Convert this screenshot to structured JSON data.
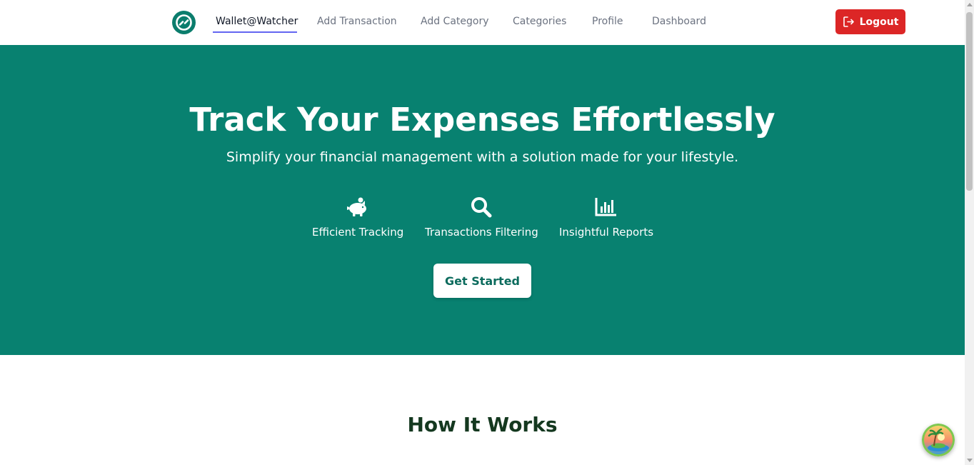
{
  "nav": {
    "brand": "Wallet@Watcher",
    "links": [
      "Add Transaction",
      "Add Category",
      "Categories",
      "Profile",
      "Dashboard"
    ],
    "logout_label": "Logout",
    "accent_color": "#6366f1",
    "logout_color": "#dc2626"
  },
  "hero": {
    "title": "Track Your Expenses Effortlessly",
    "subtitle": "Simplify your financial management with a solution made for your lifestyle.",
    "background_color": "#088170",
    "features": [
      {
        "icon": "piggy-bank-icon",
        "label": "Efficient Tracking"
      },
      {
        "icon": "search-icon",
        "label": "Transactions Filtering"
      },
      {
        "icon": "bar-chart-icon",
        "label": "Insightful Reports"
      }
    ],
    "cta_label": "Get Started"
  },
  "how_it_works": {
    "title": "How It Works"
  }
}
